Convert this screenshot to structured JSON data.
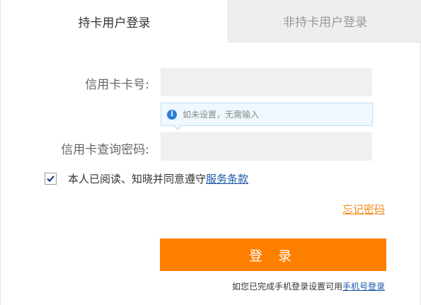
{
  "tabs": [
    {
      "label": "持卡用户登录",
      "active": true
    },
    {
      "label": "非持卡用户登录",
      "active": false
    }
  ],
  "form": {
    "card_label": "信用卡卡号:",
    "card_value": "",
    "tip_text": "如未设置，无需输入",
    "password_label": "信用卡查询密码:",
    "password_value": ""
  },
  "agreement": {
    "checked": true,
    "text": "本人已阅读、知晓并同意遵守",
    "link": "服务条款"
  },
  "forgot_password": "忘记密码",
  "login_button": "登 录",
  "phone_note": {
    "text": "如您已完成手机登录设置可用",
    "link": "手机号登录"
  },
  "colors": {
    "accent": "#ff7f00",
    "link": "#1a56a8",
    "forgot": "#f08a1c",
    "tip_bg": "#eef8fd",
    "info_icon": "#2a7fd6"
  },
  "icons": {
    "tip": "info-icon",
    "checkbox": "checkmark-icon"
  }
}
